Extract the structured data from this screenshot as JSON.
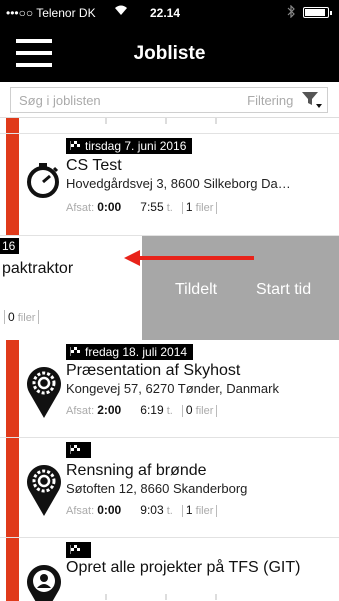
{
  "status": {
    "carrier": "•••○○ Telenor DK",
    "time": "22.14",
    "battery_level": 0.9
  },
  "nav": {
    "title": "Jobliste"
  },
  "search": {
    "placeholder": "Søg i joblisten",
    "filter_label": "Filtering"
  },
  "swiped_item": {
    "num": "16",
    "title": "paktraktor",
    "files_count": "0",
    "files_unit": "filer",
    "action_assign": "Tildelt",
    "action_start": "Start tid"
  },
  "jobs": [
    {
      "date": "tirsdag 7. juni 2016",
      "title": "CS Test",
      "address": "Hovedgårdsvej 3, 8600 Silkeborg Da…",
      "afsat_label": "Afsat:",
      "afsat": "0:00",
      "hours": "7:55",
      "hours_unit": "t.",
      "files_count": "1",
      "files_unit": "filer",
      "icon": "stopwatch-icon"
    },
    {
      "date": "fredag 18. juli 2014",
      "title": "Præsentation af Skyhost",
      "address": "Kongevej 57, 6270 Tønder, Danmark",
      "afsat_label": "Afsat:",
      "afsat": "2:00",
      "hours": "6:19",
      "hours_unit": "t.",
      "files_count": "0",
      "files_unit": "filer",
      "icon": "gear-pin-icon"
    },
    {
      "date": "",
      "title": "Rensning af brønde",
      "address": "Søtoften 12, 8660 Skanderborg",
      "afsat_label": "Afsat:",
      "afsat": "0:00",
      "hours": "9:03",
      "hours_unit": "t.",
      "files_count": "1",
      "files_unit": "filer",
      "icon": "gear-pin-icon"
    },
    {
      "date": "",
      "title": "Opret alle projekter på TFS (GIT)",
      "icon": "person-pin-icon"
    }
  ],
  "colors": {
    "accent": "#e03a1a",
    "swipe_bg": "#a7a7a7",
    "arrow": "#e8231a"
  }
}
